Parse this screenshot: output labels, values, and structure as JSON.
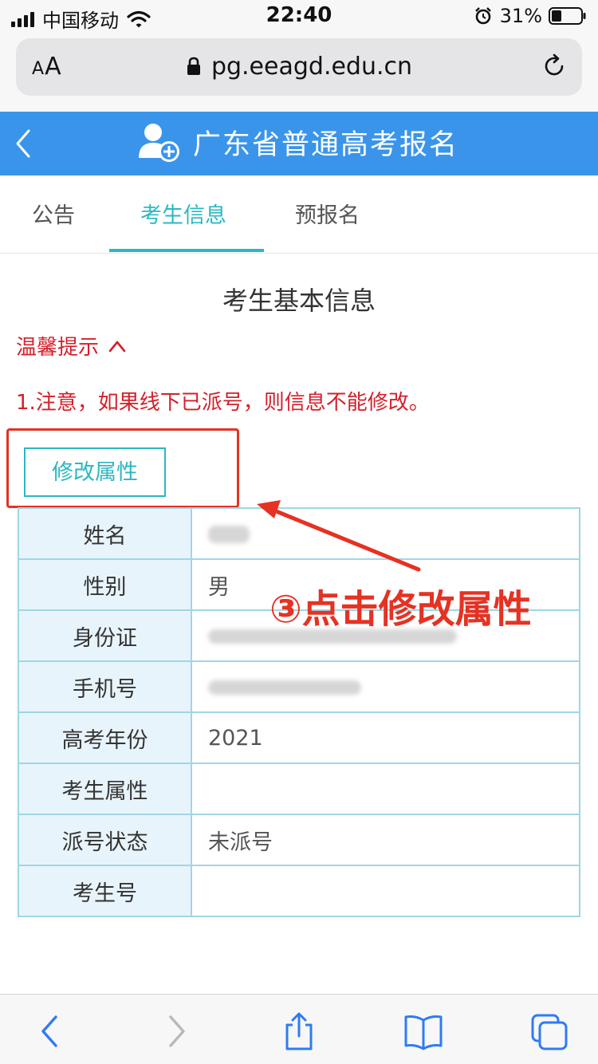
{
  "status_bar": {
    "carrier": "中国移动",
    "time": "22:40",
    "battery": "31%",
    "icons": [
      "signal-icon",
      "wifi-icon",
      "alarm-icon",
      "battery-icon"
    ]
  },
  "browser": {
    "text_size_small": "A",
    "text_size_large": "A",
    "url": "pg.eeagd.edu.cn",
    "icons": [
      "lock-icon",
      "reload-icon"
    ]
  },
  "header": {
    "title": "广东省普通高考报名",
    "icons": [
      "back-chevron-icon",
      "user-add-icon"
    ],
    "color": "#3a95ea"
  },
  "tabs": [
    {
      "label": "公告",
      "active": false
    },
    {
      "label": "考生信息",
      "active": true
    },
    {
      "label": "预报名",
      "active": false
    }
  ],
  "main": {
    "section_title": "考生基本信息",
    "tips_label": "温馨提示",
    "notice": "1.注意，如果线下已派号，则信息不能修改。",
    "edit_button": "修改属性"
  },
  "info_rows": [
    {
      "key": "姓名",
      "value": ""
    },
    {
      "key": "性别",
      "value": "男"
    },
    {
      "key": "身份证",
      "value": ""
    },
    {
      "key": "手机号",
      "value": ""
    },
    {
      "key": "高考年份",
      "value": "2021"
    },
    {
      "key": "考生属性",
      "value": ""
    },
    {
      "key": "派号状态",
      "value": "未派号"
    },
    {
      "key": "考生号",
      "value": ""
    }
  ],
  "annotation": {
    "text": "③点击修改属性",
    "color": "#e53223"
  },
  "toolbar": {
    "icons": [
      "back-icon",
      "forward-icon",
      "share-icon",
      "bookmarks-icon",
      "tabs-icon"
    ]
  },
  "colors": {
    "accent": "#2bb8c1",
    "warning": "#d3202b",
    "table_border": "#9fd6e6",
    "table_key_bg": "#e8f4fb"
  }
}
